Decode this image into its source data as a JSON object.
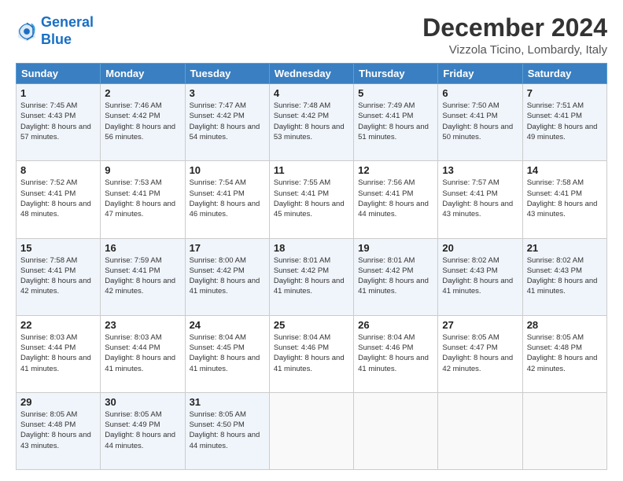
{
  "logo": {
    "line1": "General",
    "line2": "Blue"
  },
  "header": {
    "month": "December 2024",
    "location": "Vizzola Ticino, Lombardy, Italy"
  },
  "weekdays": [
    "Sunday",
    "Monday",
    "Tuesday",
    "Wednesday",
    "Thursday",
    "Friday",
    "Saturday"
  ],
  "weeks": [
    [
      {
        "day": "1",
        "sunrise": "Sunrise: 7:45 AM",
        "sunset": "Sunset: 4:43 PM",
        "daylight": "Daylight: 8 hours and 57 minutes."
      },
      {
        "day": "2",
        "sunrise": "Sunrise: 7:46 AM",
        "sunset": "Sunset: 4:42 PM",
        "daylight": "Daylight: 8 hours and 56 minutes."
      },
      {
        "day": "3",
        "sunrise": "Sunrise: 7:47 AM",
        "sunset": "Sunset: 4:42 PM",
        "daylight": "Daylight: 8 hours and 54 minutes."
      },
      {
        "day": "4",
        "sunrise": "Sunrise: 7:48 AM",
        "sunset": "Sunset: 4:42 PM",
        "daylight": "Daylight: 8 hours and 53 minutes."
      },
      {
        "day": "5",
        "sunrise": "Sunrise: 7:49 AM",
        "sunset": "Sunset: 4:41 PM",
        "daylight": "Daylight: 8 hours and 51 minutes."
      },
      {
        "day": "6",
        "sunrise": "Sunrise: 7:50 AM",
        "sunset": "Sunset: 4:41 PM",
        "daylight": "Daylight: 8 hours and 50 minutes."
      },
      {
        "day": "7",
        "sunrise": "Sunrise: 7:51 AM",
        "sunset": "Sunset: 4:41 PM",
        "daylight": "Daylight: 8 hours and 49 minutes."
      }
    ],
    [
      {
        "day": "8",
        "sunrise": "Sunrise: 7:52 AM",
        "sunset": "Sunset: 4:41 PM",
        "daylight": "Daylight: 8 hours and 48 minutes."
      },
      {
        "day": "9",
        "sunrise": "Sunrise: 7:53 AM",
        "sunset": "Sunset: 4:41 PM",
        "daylight": "Daylight: 8 hours and 47 minutes."
      },
      {
        "day": "10",
        "sunrise": "Sunrise: 7:54 AM",
        "sunset": "Sunset: 4:41 PM",
        "daylight": "Daylight: 8 hours and 46 minutes."
      },
      {
        "day": "11",
        "sunrise": "Sunrise: 7:55 AM",
        "sunset": "Sunset: 4:41 PM",
        "daylight": "Daylight: 8 hours and 45 minutes."
      },
      {
        "day": "12",
        "sunrise": "Sunrise: 7:56 AM",
        "sunset": "Sunset: 4:41 PM",
        "daylight": "Daylight: 8 hours and 44 minutes."
      },
      {
        "day": "13",
        "sunrise": "Sunrise: 7:57 AM",
        "sunset": "Sunset: 4:41 PM",
        "daylight": "Daylight: 8 hours and 43 minutes."
      },
      {
        "day": "14",
        "sunrise": "Sunrise: 7:58 AM",
        "sunset": "Sunset: 4:41 PM",
        "daylight": "Daylight: 8 hours and 43 minutes."
      }
    ],
    [
      {
        "day": "15",
        "sunrise": "Sunrise: 7:58 AM",
        "sunset": "Sunset: 4:41 PM",
        "daylight": "Daylight: 8 hours and 42 minutes."
      },
      {
        "day": "16",
        "sunrise": "Sunrise: 7:59 AM",
        "sunset": "Sunset: 4:41 PM",
        "daylight": "Daylight: 8 hours and 42 minutes."
      },
      {
        "day": "17",
        "sunrise": "Sunrise: 8:00 AM",
        "sunset": "Sunset: 4:42 PM",
        "daylight": "Daylight: 8 hours and 41 minutes."
      },
      {
        "day": "18",
        "sunrise": "Sunrise: 8:01 AM",
        "sunset": "Sunset: 4:42 PM",
        "daylight": "Daylight: 8 hours and 41 minutes."
      },
      {
        "day": "19",
        "sunrise": "Sunrise: 8:01 AM",
        "sunset": "Sunset: 4:42 PM",
        "daylight": "Daylight: 8 hours and 41 minutes."
      },
      {
        "day": "20",
        "sunrise": "Sunrise: 8:02 AM",
        "sunset": "Sunset: 4:43 PM",
        "daylight": "Daylight: 8 hours and 41 minutes."
      },
      {
        "day": "21",
        "sunrise": "Sunrise: 8:02 AM",
        "sunset": "Sunset: 4:43 PM",
        "daylight": "Daylight: 8 hours and 41 minutes."
      }
    ],
    [
      {
        "day": "22",
        "sunrise": "Sunrise: 8:03 AM",
        "sunset": "Sunset: 4:44 PM",
        "daylight": "Daylight: 8 hours and 41 minutes."
      },
      {
        "day": "23",
        "sunrise": "Sunrise: 8:03 AM",
        "sunset": "Sunset: 4:44 PM",
        "daylight": "Daylight: 8 hours and 41 minutes."
      },
      {
        "day": "24",
        "sunrise": "Sunrise: 8:04 AM",
        "sunset": "Sunset: 4:45 PM",
        "daylight": "Daylight: 8 hours and 41 minutes."
      },
      {
        "day": "25",
        "sunrise": "Sunrise: 8:04 AM",
        "sunset": "Sunset: 4:46 PM",
        "daylight": "Daylight: 8 hours and 41 minutes."
      },
      {
        "day": "26",
        "sunrise": "Sunrise: 8:04 AM",
        "sunset": "Sunset: 4:46 PM",
        "daylight": "Daylight: 8 hours and 41 minutes."
      },
      {
        "day": "27",
        "sunrise": "Sunrise: 8:05 AM",
        "sunset": "Sunset: 4:47 PM",
        "daylight": "Daylight: 8 hours and 42 minutes."
      },
      {
        "day": "28",
        "sunrise": "Sunrise: 8:05 AM",
        "sunset": "Sunset: 4:48 PM",
        "daylight": "Daylight: 8 hours and 42 minutes."
      }
    ],
    [
      {
        "day": "29",
        "sunrise": "Sunrise: 8:05 AM",
        "sunset": "Sunset: 4:48 PM",
        "daylight": "Daylight: 8 hours and 43 minutes."
      },
      {
        "day": "30",
        "sunrise": "Sunrise: 8:05 AM",
        "sunset": "Sunset: 4:49 PM",
        "daylight": "Daylight: 8 hours and 44 minutes."
      },
      {
        "day": "31",
        "sunrise": "Sunrise: 8:05 AM",
        "sunset": "Sunset: 4:50 PM",
        "daylight": "Daylight: 8 hours and 44 minutes."
      },
      null,
      null,
      null,
      null
    ]
  ]
}
